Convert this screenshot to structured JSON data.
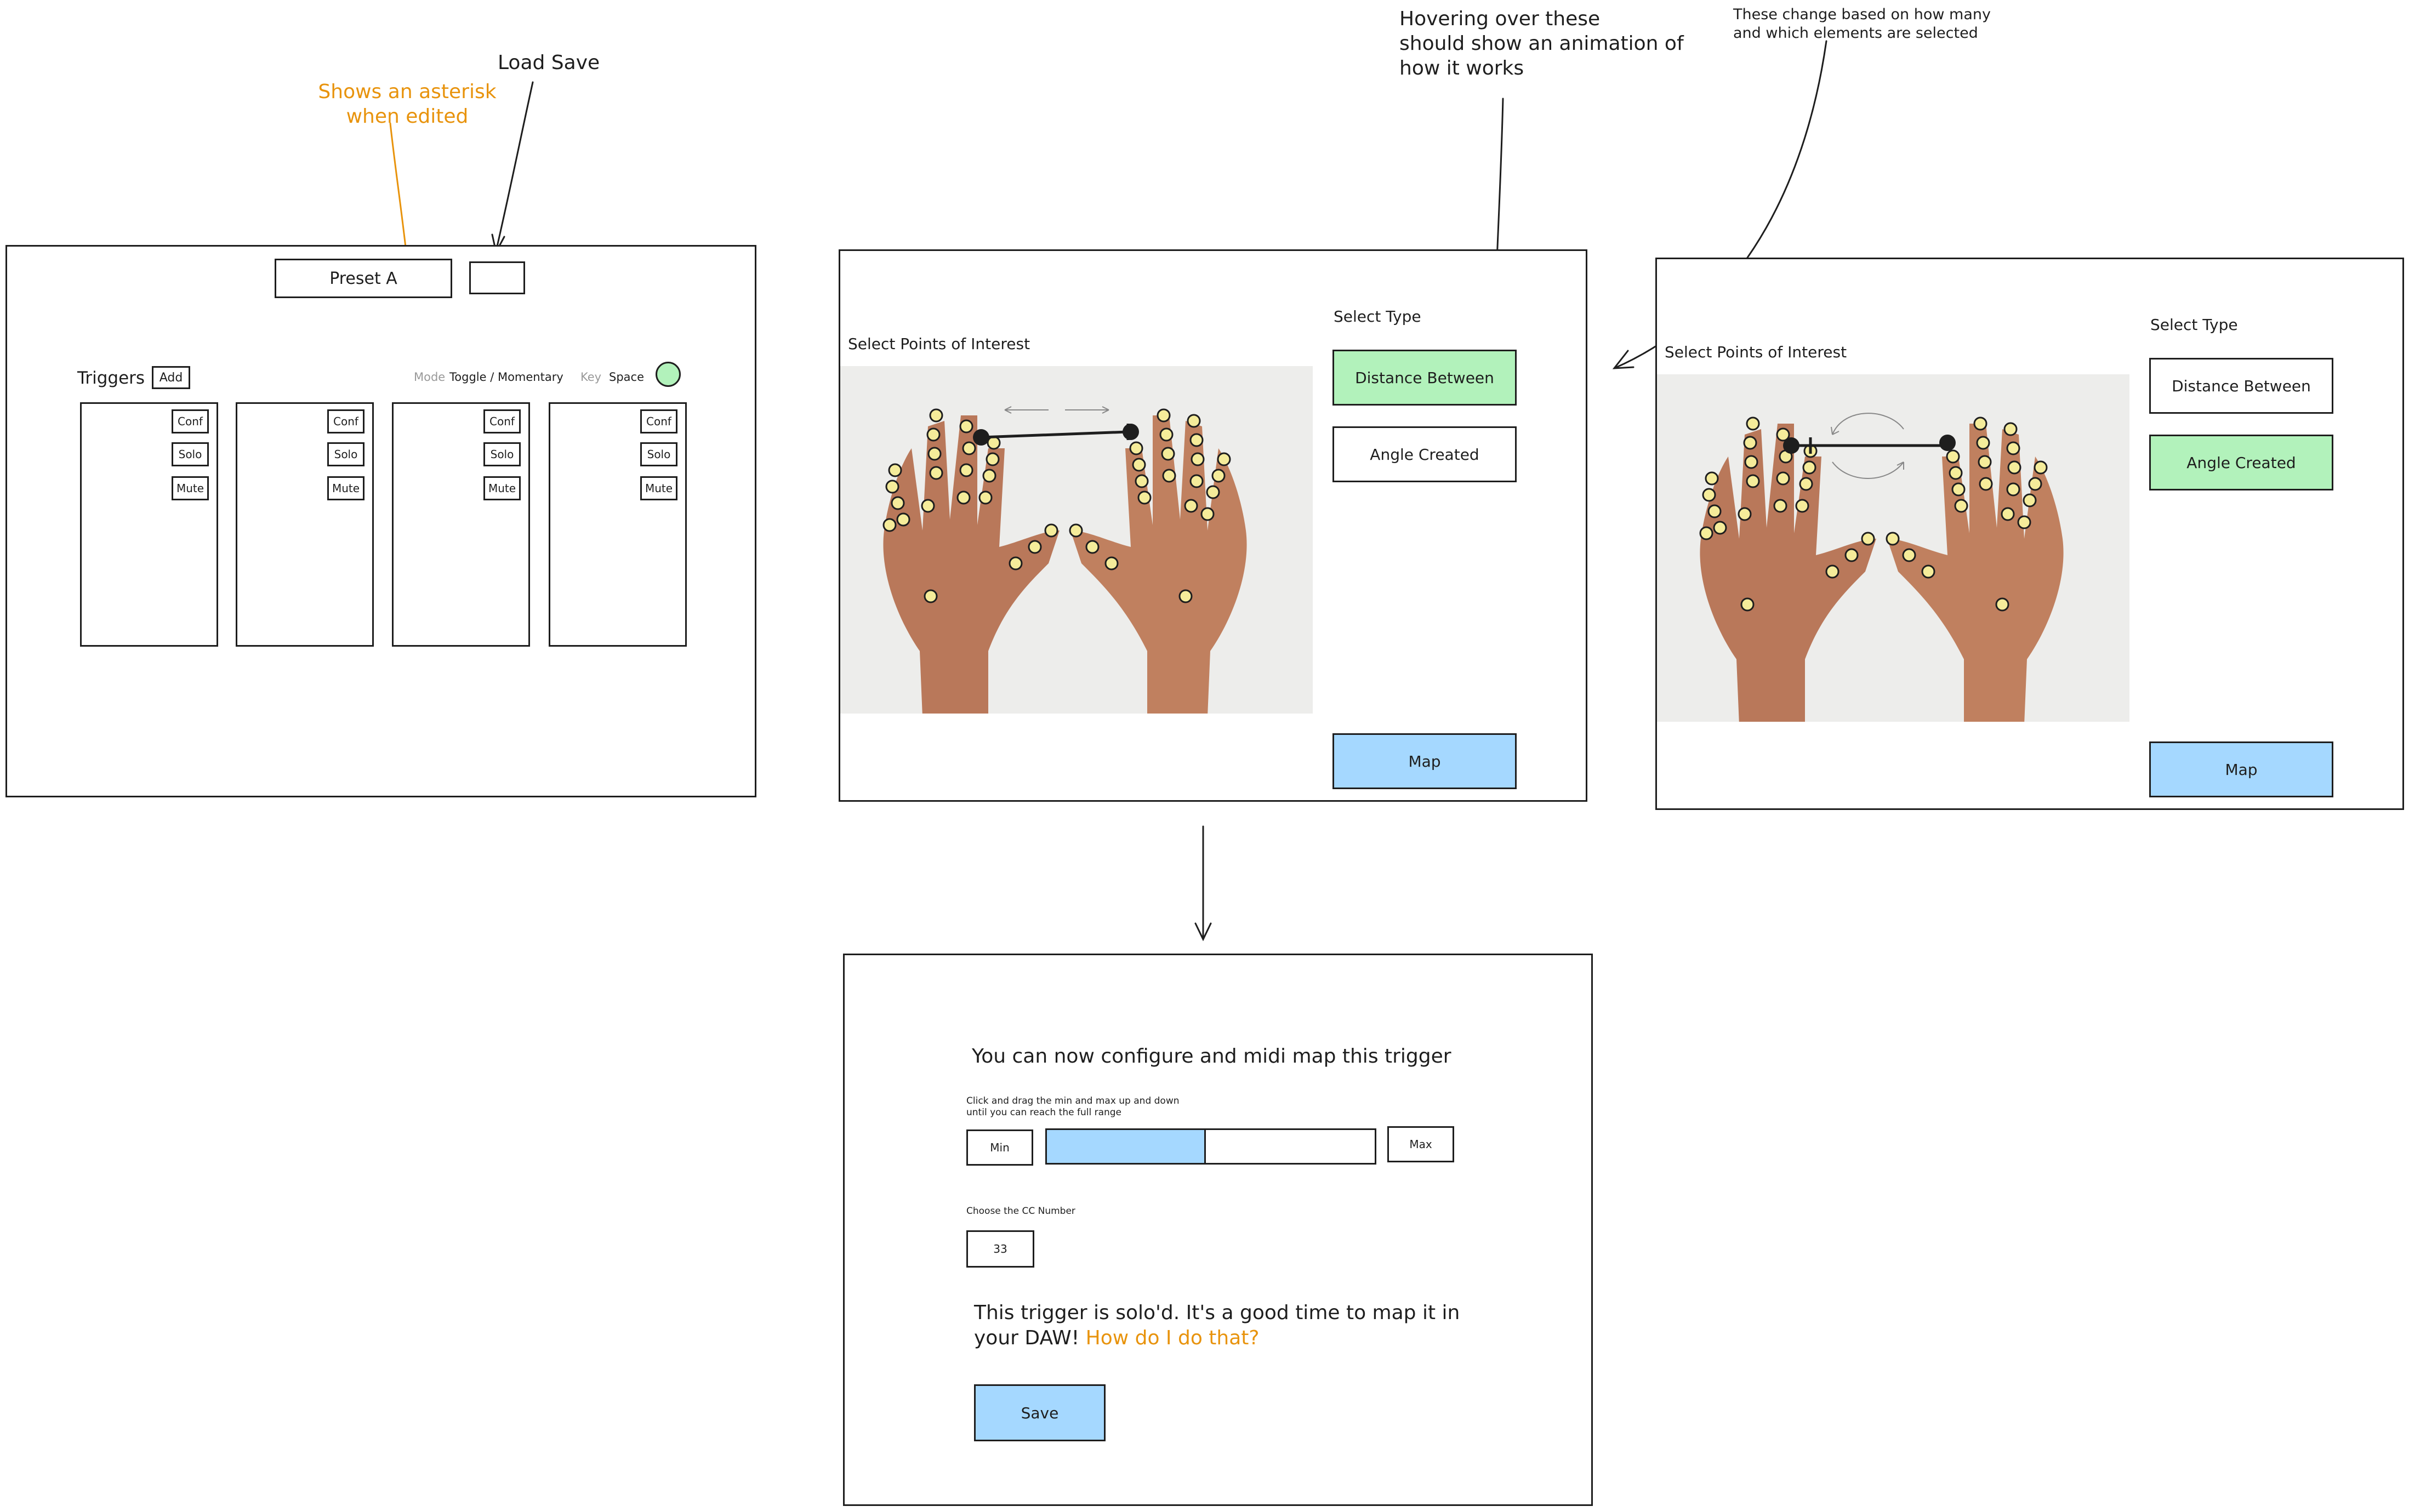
{
  "annotations": {
    "asterisk_note": "Shows an asterisk\nwhen edited",
    "load_save": "Load Save",
    "hover_note": "Hovering over these\nshould show an animation of\nhow it works",
    "change_note": "These change based on how many\nand which elements are selected"
  },
  "screen1": {
    "preset_label": "Preset A",
    "triggers_label": "Triggers",
    "add_label": "Add",
    "mode_label": "Mode",
    "mode_value": "Toggle / Momentary",
    "key_label": "Key",
    "key_value": "Space",
    "indicator_color": "#b2f2bb",
    "trigger_cards": [
      {
        "conf": "Conf",
        "solo": "Solo",
        "mute": "Mute"
      },
      {
        "conf": "Conf",
        "solo": "Solo",
        "mute": "Mute"
      },
      {
        "conf": "Conf",
        "solo": "Solo",
        "mute": "Mute"
      },
      {
        "conf": "Conf",
        "solo": "Solo",
        "mute": "Mute"
      }
    ]
  },
  "screen2": {
    "points_label": "Select Points of Interest",
    "type_label": "Select Type",
    "distance_label": "Distance Between",
    "angle_label": "Angle Created",
    "map_label": "Map",
    "selected": "distance"
  },
  "screen3": {
    "points_label": "Select Points of Interest",
    "type_label": "Select Type",
    "distance_label": "Distance Between",
    "angle_label": "Angle Created",
    "map_label": "Map",
    "selected": "angle"
  },
  "screen4": {
    "heading": "You can now configure and midi map this trigger",
    "range_hint": "Click and drag the min and max up and down\nuntil you can reach the full range",
    "min_label": "Min",
    "max_label": "Max",
    "range_fill": 0.48,
    "cc_label": "Choose the CC Number",
    "cc_value": "33",
    "solo_text_1": "This trigger is solo'd. It's a good time to map it in",
    "solo_text_2": "your DAW!",
    "help_link": "How do I do that?",
    "save_label": "Save"
  },
  "colors": {
    "selected_green": "#b2f2bb",
    "action_blue": "#a5d8ff",
    "annotation_orange": "#e8930c",
    "landmark_yellow": "#f5ec9a"
  }
}
